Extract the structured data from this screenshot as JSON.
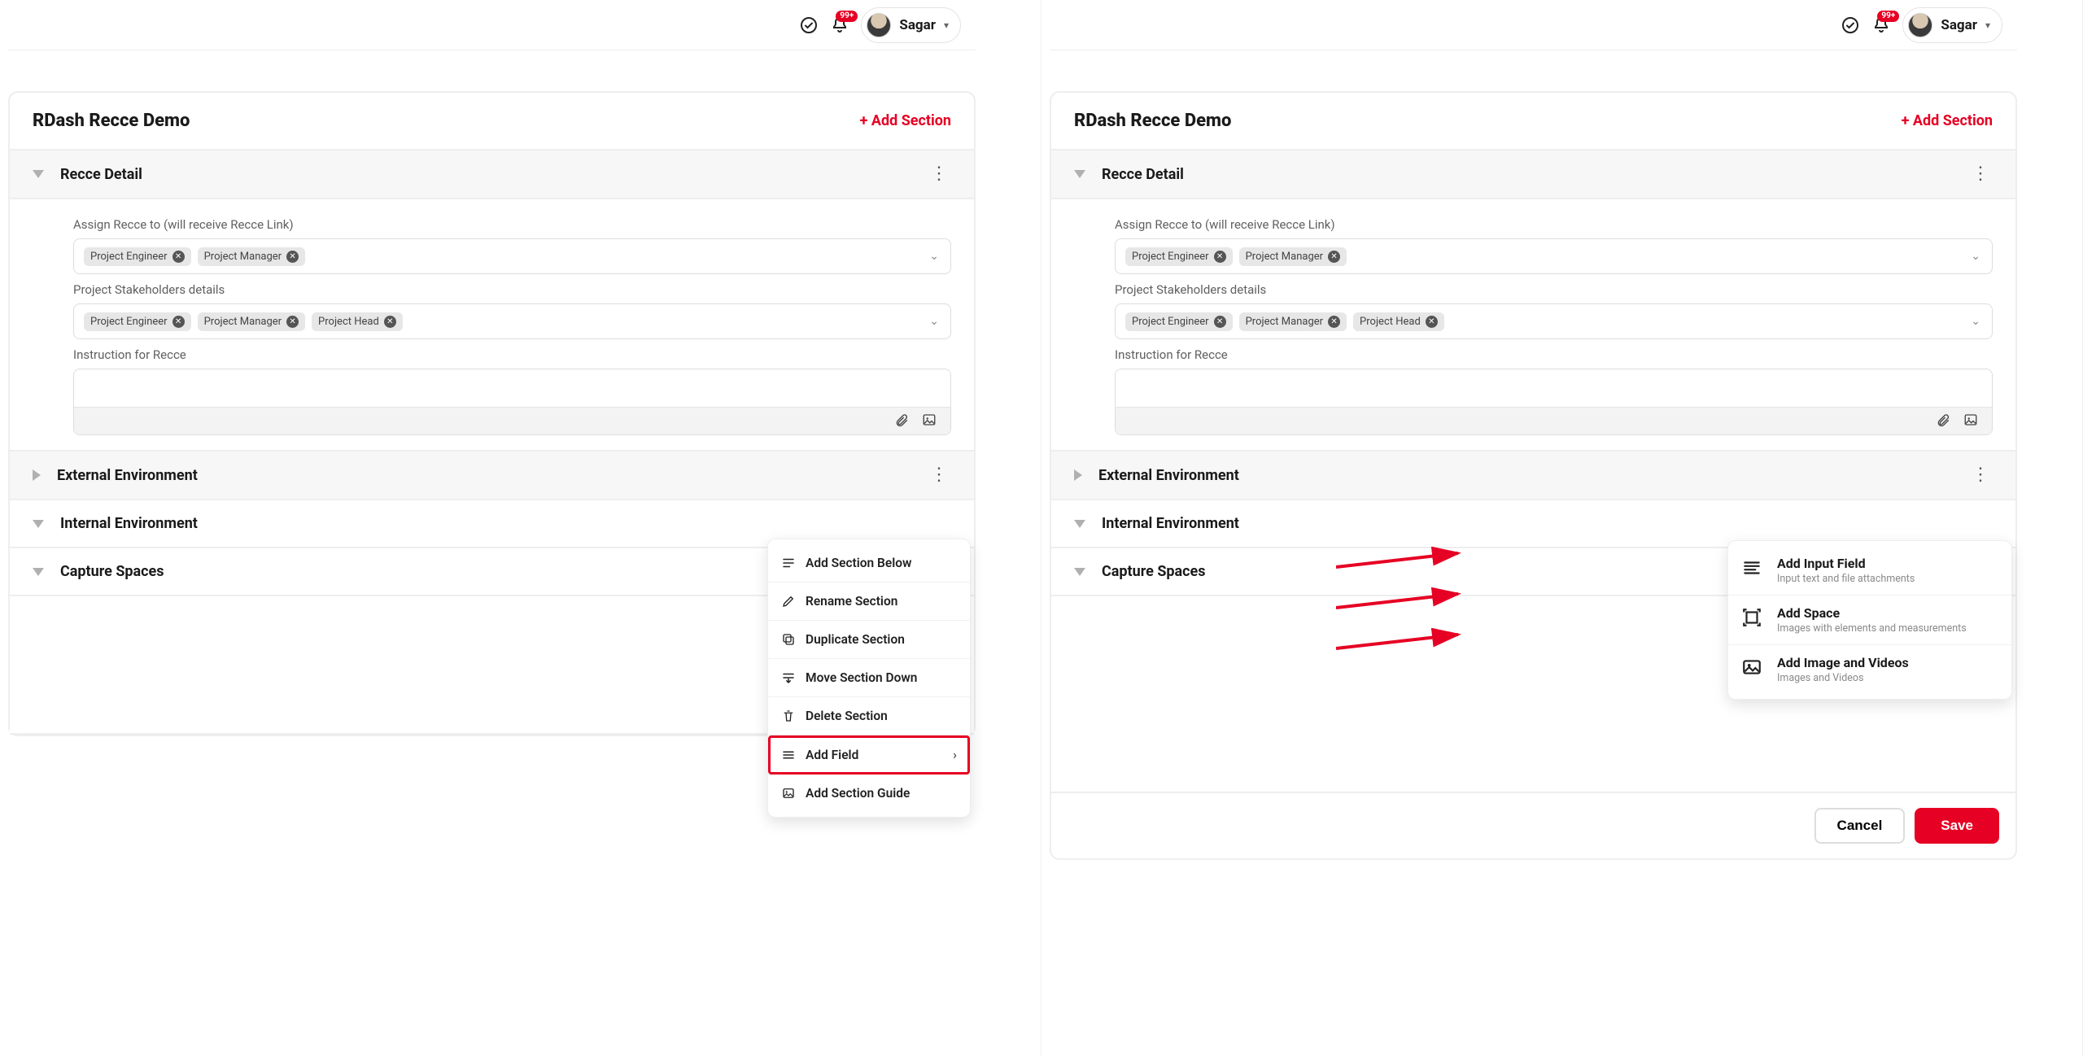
{
  "topbar": {
    "notif_badge": "99+",
    "user_name": "Sagar"
  },
  "panel": {
    "title": "RDash Recce Demo",
    "add_section_label": "+ Add Section"
  },
  "sections": {
    "recce_detail": "Recce Detail",
    "external_env": "External Environment",
    "internal_env": "Internal Environment",
    "capture_spaces": "Capture Spaces"
  },
  "fields": {
    "assign_label": "Assign Recce to (will receive Recce Link)",
    "assign_chips": [
      "Project Engineer",
      "Project Manager"
    ],
    "stakeholders_label": "Project Stakeholders details",
    "stakeholders_chips": [
      "Project Engineer",
      "Project Manager",
      "Project Head"
    ],
    "instruction_label": "Instruction for Recce"
  },
  "context_menu": {
    "add_below": "Add Section Below",
    "rename": "Rename Section",
    "duplicate": "Duplicate Section",
    "move_down": "Move Section Down",
    "delete": "Delete Section",
    "add_field": "Add Field",
    "add_guide": "Add Section Guide"
  },
  "field_options": {
    "input_title": "Add Input Field",
    "input_sub": "Input text and file attachments",
    "space_title": "Add Space",
    "space_sub": "Images with elements and measurements",
    "media_title": "Add Image and Videos",
    "media_sub": "Images and Videos"
  },
  "footer": {
    "cancel": "Cancel",
    "save": "Save"
  }
}
